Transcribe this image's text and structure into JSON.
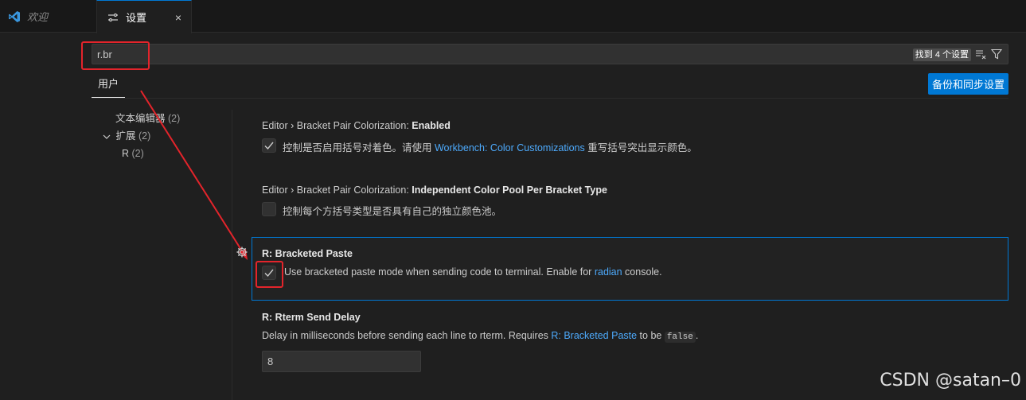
{
  "tabs": {
    "welcome": {
      "label": "欢迎",
      "icon": "vscode-icon"
    },
    "settings": {
      "label": "设置",
      "icon": "settings-icon",
      "close": "×"
    }
  },
  "search": {
    "value": "r.br",
    "placeholder": "",
    "result_count": "找到 4 个设置",
    "clear_icon": "clear-filter-icon",
    "filter_icon": "filter-icon"
  },
  "scope": {
    "user_tab": "用户"
  },
  "sync_button": "备份和同步设置",
  "toc": [
    {
      "label": "文本编辑器",
      "count": "(2)"
    },
    {
      "label": "扩展",
      "count": "(2)"
    },
    {
      "label": "R",
      "count": "(2)"
    }
  ],
  "settings": [
    {
      "category": "Editor › Bracket Pair Colorization: ",
      "name": "Enabled",
      "desc_pre": "控制是否启用括号对着色。请使用 ",
      "desc_link": "Workbench: Color Customizations",
      "desc_post": " 重写括号突出显示颜色。",
      "checked": true
    },
    {
      "category": "Editor › Bracket Pair Colorization: ",
      "name": "Independent Color Pool Per Bracket Type",
      "desc": "控制每个方括号类型是否具有自己的独立颜色池。",
      "checked": false
    },
    {
      "category": "R: ",
      "name": "Bracketed Paste",
      "desc_pre": "Use bracketed paste mode when sending code to terminal. Enable for ",
      "desc_link": "radian",
      "desc_post": " console.",
      "checked": true
    },
    {
      "category": "R: ",
      "name": "Rterm Send Delay",
      "desc_pre": "Delay in milliseconds before sending each line to rterm. Requires ",
      "desc_link": "R: Bracketed Paste",
      "desc_mid": " to be ",
      "desc_code": "false",
      "desc_post": ".",
      "value": "8"
    }
  ],
  "watermark": "CSDN @satan–0",
  "colors": {
    "accent": "#0078d4",
    "link": "#4daafc",
    "annotation": "#e3242b"
  }
}
